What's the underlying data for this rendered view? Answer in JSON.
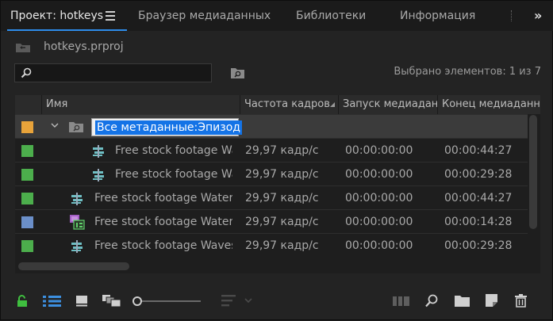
{
  "tabs": [
    {
      "label": "Проект: hotkeys",
      "active": true
    },
    {
      "label": "Браузер медиаданных",
      "active": false
    },
    {
      "label": "Библиотеки",
      "active": false
    },
    {
      "label": "Информация",
      "active": false
    }
  ],
  "overflow_label": "»",
  "project": {
    "name": "hotkeys.prproj"
  },
  "search": {
    "value": "",
    "placeholder": ""
  },
  "selection_count": "Выбрано элементов: 1 из 7",
  "table": {
    "columns": [
      "Имя",
      "Частота кадров",
      "Запуск медиадан",
      "Конец медиаданн"
    ],
    "bin_row": {
      "label_color": "#e8a33a",
      "name_editing": "Все метаданные:Эпизод"
    },
    "rows": [
      {
        "label_color": "#4cae4c",
        "icon": "sequence-icon",
        "name": "Free stock footage Wat",
        "fps": "29,97 кадр/с",
        "start": "00:00:00:00",
        "end": "00:00:44:27"
      },
      {
        "label_color": "#4cae4c",
        "icon": "sequence-icon",
        "name": "Free stock footage Wav",
        "fps": "29,97 кадр/с",
        "start": "00:00:00:00",
        "end": "00:00:29:28"
      },
      {
        "label_color": "#4cae4c",
        "icon": "sequence-icon",
        "name": "Free stock footage Waterfal",
        "fps": "29,97 кадр/с",
        "start": "00:00:00:00",
        "end": "00:00:44:27"
      },
      {
        "label_color": "#6b8fc9",
        "icon": "multicam-sequence-icon",
        "name": "Free stock footage Waterfal",
        "fps": "29,97 кадр/с",
        "start": "00:00:00:00",
        "end": "00:00:14:28"
      },
      {
        "label_color": "#4cae4c",
        "icon": "sequence-icon",
        "name": "Free stock footage Waves in",
        "fps": "29,97 кадр/с",
        "start": "00:00:00:00",
        "end": "00:00:29:28"
      }
    ]
  },
  "colors": {
    "accent": "#2d8ceb",
    "lock": "#3fbf3f",
    "list_view": "#3c8fe0"
  },
  "bottom_icons": [
    "lock-icon",
    "list-view-icon",
    "icon-view-icon",
    "freeform-view-icon",
    "zoom-slider",
    "sort-icons-icon",
    "automate-to-sequence-icon",
    "find-icon",
    "new-bin-icon",
    "new-item-icon",
    "clear-icon"
  ],
  "zoom_level": 0.0
}
